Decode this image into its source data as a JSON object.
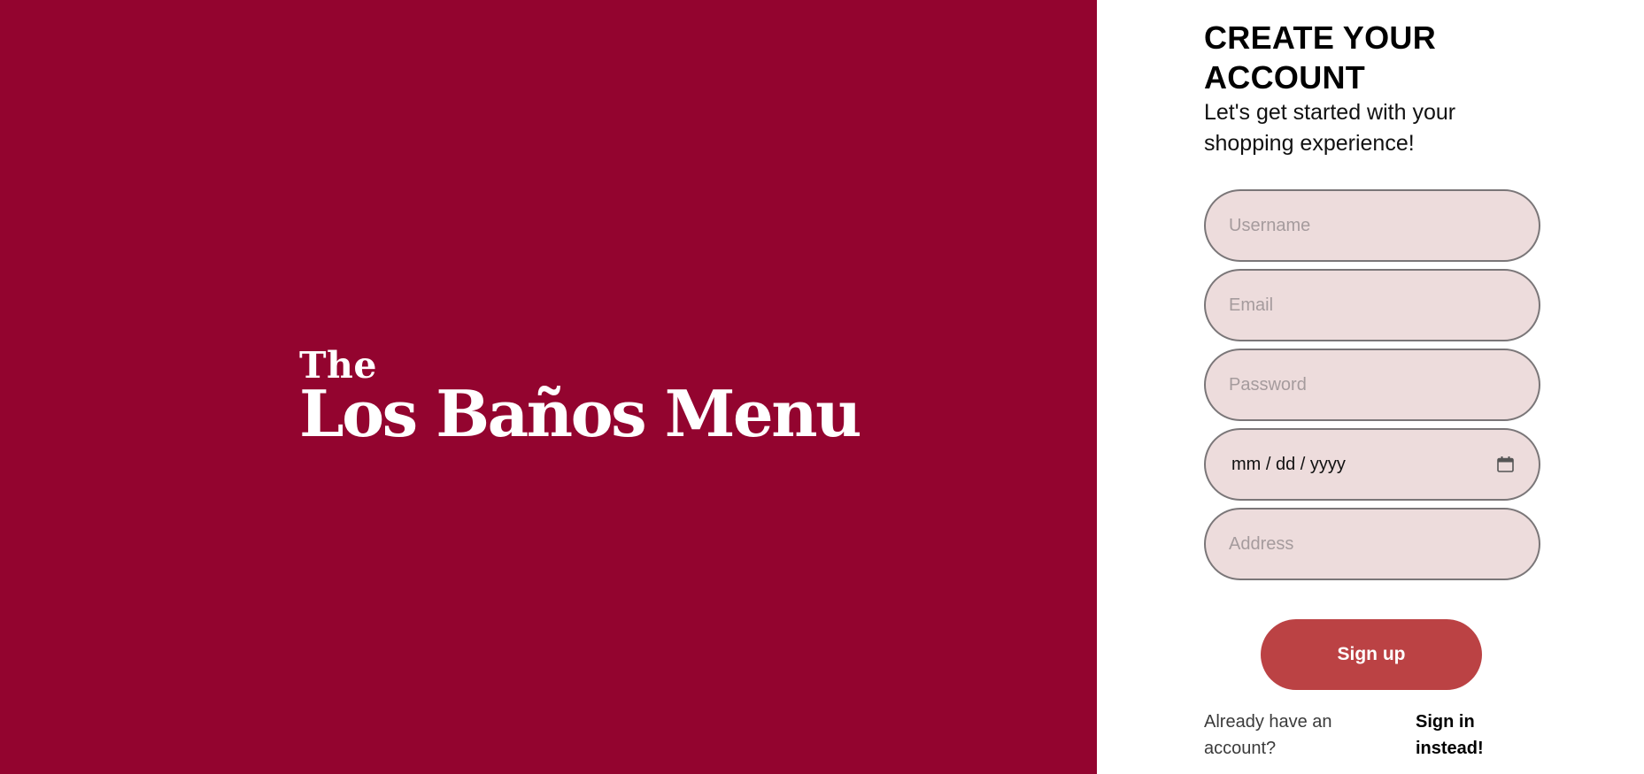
{
  "brand": {
    "the": "The",
    "name": "Los Baños Menu",
    "panel_color": "#93042f"
  },
  "form": {
    "heading": "CREATE YOUR ACCOUNT",
    "subheading": "Let's get started with your shopping experience!",
    "fields": {
      "username": {
        "placeholder": "Username"
      },
      "email": {
        "placeholder": "Email"
      },
      "password": {
        "placeholder": "Password"
      },
      "birthdate": {
        "value": "mm / dd / yyyy",
        "icon": "calendar-icon"
      },
      "address": {
        "placeholder": "Address"
      }
    },
    "signup_label": "Sign up",
    "signup_color": "#bb4244",
    "field_bg": "#eddcdc"
  },
  "footer": {
    "already_text": "Already have an account?",
    "signin_label": "Sign in instead!"
  }
}
